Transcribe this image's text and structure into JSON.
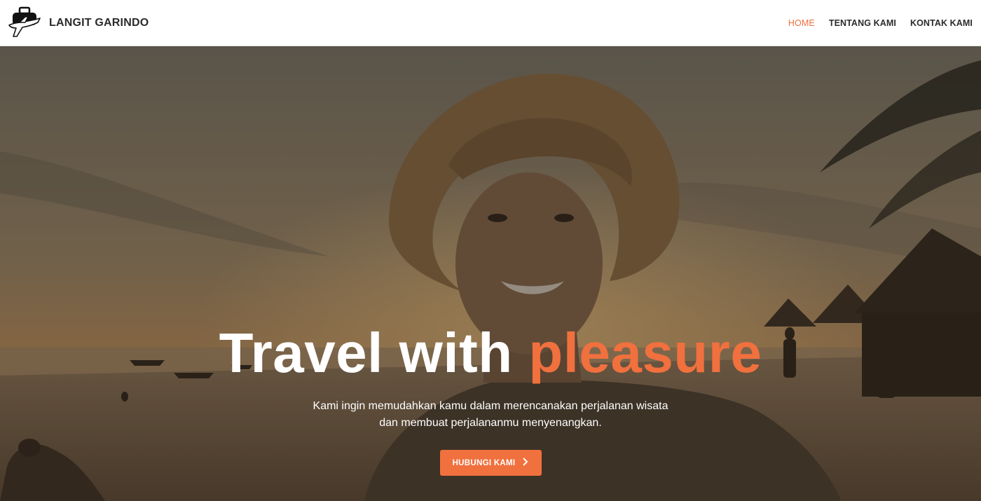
{
  "header": {
    "brand_name": "LANGIT GARINDO",
    "logo_icon": "luggage-airplane-icon",
    "nav": [
      {
        "label": "HOME",
        "active": true
      },
      {
        "label": "TENTANG KAMI",
        "active": false
      },
      {
        "label": "KONTAK KAMI",
        "active": false
      }
    ]
  },
  "hero": {
    "headline_main": "Travel with",
    "headline_accent": "pleasure",
    "subtitle_line1": "Kami ingin memudahkan kamu dalam merencanakan perjalanan wisata",
    "subtitle_line2": "dan membuat perjalananmu menyenangkan.",
    "cta_label": "HUBUNGI KAMI",
    "cta_icon": "chevron-right-icon"
  },
  "colors": {
    "accent": "#f0703e",
    "text_dark": "#2b2b2b",
    "white": "#ffffff"
  }
}
